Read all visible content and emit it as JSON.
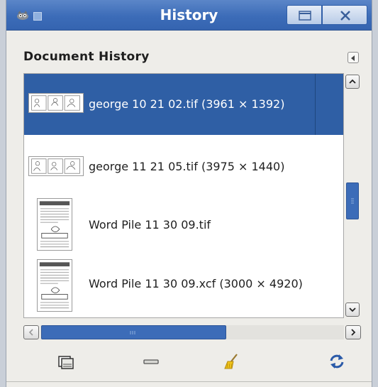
{
  "window": {
    "title": "History",
    "icon": "gimp-wilber-icon",
    "buttons": {
      "minimize": "minimize-icon",
      "close": "close-icon"
    }
  },
  "panel": {
    "title": "Document History",
    "menu_icon": "panel-menu-arrow-icon"
  },
  "items": [
    {
      "label": "george 10 21 02.tif (3961 × 1392)",
      "selected": true,
      "thumb": "comic-strip-thumbnail"
    },
    {
      "label": "george 11 21 05.tif (3975 × 1440)",
      "selected": false,
      "thumb": "comic-strip-thumbnail"
    },
    {
      "label": "Word Pile 11 30 09.tif",
      "selected": false,
      "thumb": "word-puzzle-thumbnail"
    },
    {
      "label": "Word Pile 11 30 09.xcf (3000 × 4920)",
      "selected": false,
      "thumb": "word-puzzle-thumbnail"
    }
  ],
  "scroll": {
    "vertical_position": 0.55,
    "horizontal_position": 0.0
  },
  "toolbar": [
    {
      "name": "open-image-button",
      "icon": "open-image-icon"
    },
    {
      "name": "remove-entry-button",
      "icon": "minus-icon"
    },
    {
      "name": "clear-history-button",
      "icon": "broom-icon"
    },
    {
      "name": "refresh-previews-button",
      "icon": "refresh-icon"
    }
  ],
  "colors": {
    "accent": "#3c6cb8",
    "selection": "#2f5fa5"
  }
}
